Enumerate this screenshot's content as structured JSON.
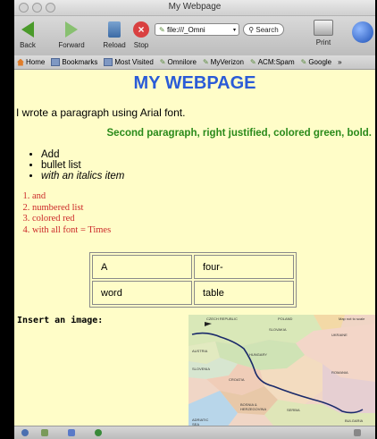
{
  "window": {
    "title": "My Webpage"
  },
  "toolbar": {
    "back_label": "Back",
    "forward_label": "Forward",
    "reload_label": "Reload",
    "stop_label": "Stop",
    "stop_glyph": "×",
    "url": "file:///_Omni",
    "search_label": "Search",
    "print_label": "Print"
  },
  "bookmarks": {
    "items": [
      "Home",
      "Bookmarks",
      "Most Visited",
      "Omnilore",
      "MyVerizon",
      "ACM:Spam",
      "Google"
    ],
    "overflow": "»"
  },
  "page": {
    "heading": "MY WEBPAGE",
    "para1": "I wrote a paragraph using Arial font.",
    "para2": "Second paragraph, right justified, colored green, bold.",
    "bullets": [
      "Add",
      "bullet list",
      "with an italics item"
    ],
    "numbered": [
      "and",
      "numbered list",
      "colored red",
      "with all font = Times"
    ],
    "table": [
      [
        "A",
        "four-"
      ],
      [
        "word",
        "table"
      ]
    ],
    "image_label": "Insert an image:",
    "map_labels": {
      "czech": "CZECH REPUBLIC",
      "poland": "POLAND",
      "slovakia": "SLOVAKIA",
      "ukraine": "UKRAINE",
      "austria": "AUSTRIA",
      "hungary": "HUNGARY",
      "slovenia": "SLOVENIA",
      "croatia": "CROATIA",
      "romania": "ROMANIA",
      "bosnia": "BOSNIA & HERZEGOVINA",
      "serbia": "SERBIA",
      "bulgaria": "BULGARIA",
      "adriatic": "ADRIATIC SEA",
      "map_not_to_scale": "Map not to scale"
    }
  },
  "colors": {
    "page_bg": "#fffdc8",
    "heading": "#2a5bd7",
    "para2": "#2a8a1a",
    "numbered": "#cc2a2a"
  }
}
